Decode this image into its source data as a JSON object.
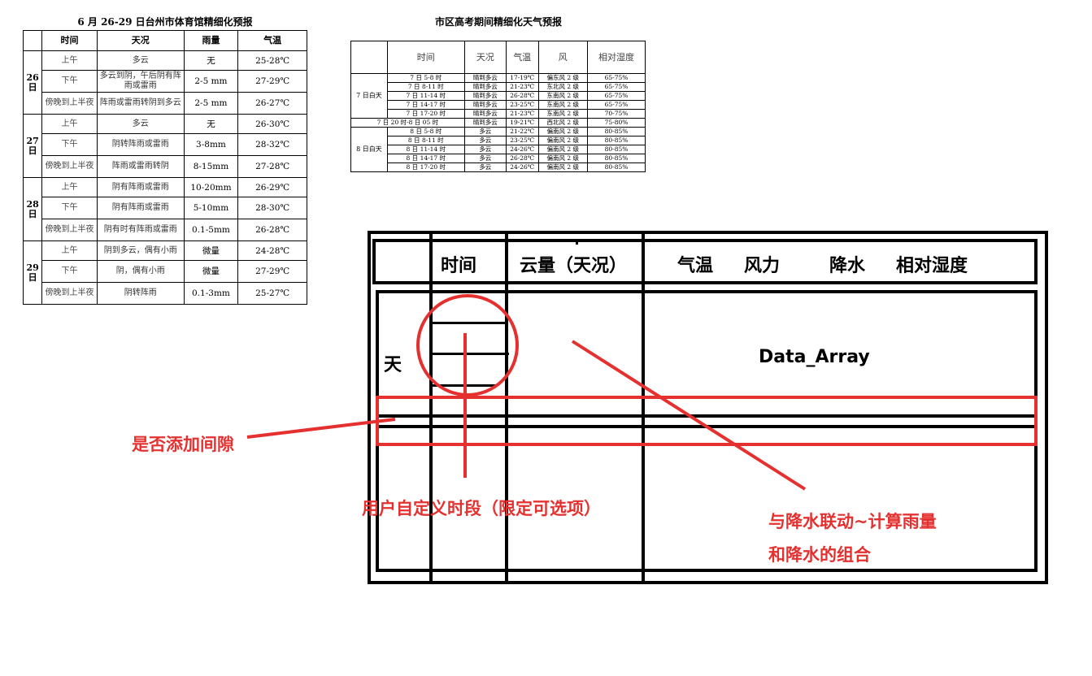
{
  "table1": {
    "title": "6 月 26-29 日台州市体育馆精细化预报",
    "headers": [
      "时间",
      "天况",
      "雨量",
      "气温"
    ],
    "days": [
      {
        "day": "26\n日",
        "rows": [
          {
            "seg": "上午",
            "wx": "多云",
            "rain": "无",
            "temp": "25-28℃"
          },
          {
            "seg": "下午",
            "wx": "多云到阴，午后阴有阵雨或雷雨",
            "rain": "2-5 mm",
            "temp": "27-29℃"
          },
          {
            "seg": "傍晚到上半夜",
            "wx": "阵雨或雷雨转阴到多云",
            "rain": "2-5 mm",
            "temp": "26-27℃"
          }
        ]
      },
      {
        "day": "27\n日",
        "rows": [
          {
            "seg": "上午",
            "wx": "多云",
            "rain": "无",
            "temp": "26-30℃"
          },
          {
            "seg": "下午",
            "wx": "阴转阵雨或雷雨",
            "rain": "3-8mm",
            "temp": "28-32℃"
          },
          {
            "seg": "傍晚到上半夜",
            "wx": "阵雨或雷雨转阴",
            "rain": "8-15mm",
            "temp": "27-28℃"
          }
        ]
      },
      {
        "day": "28\n日",
        "rows": [
          {
            "seg": "上午",
            "wx": "阴有阵雨或雷雨",
            "rain": "10-20mm",
            "temp": "26-29℃"
          },
          {
            "seg": "下午",
            "wx": "阴有阵雨或雷雨",
            "rain": "5-10mm",
            "temp": "28-30℃"
          },
          {
            "seg": "傍晚到上半夜",
            "wx": "阴有时有阵雨或雷雨",
            "rain": "0.1-5mm",
            "temp": "26-28℃"
          }
        ]
      },
      {
        "day": "29\n日",
        "rows": [
          {
            "seg": "上午",
            "wx": "阴到多云，偶有小雨",
            "rain": "微量",
            "temp": "24-28℃"
          },
          {
            "seg": "下午",
            "wx": "阴，偶有小雨",
            "rain": "微量",
            "temp": "27-29℃"
          },
          {
            "seg": "傍晚到上半夜",
            "wx": "阴转阵雨",
            "rain": "0.1-3mm",
            "temp": "25-27℃"
          }
        ]
      }
    ]
  },
  "table2": {
    "title": "市区高考期间精细化天气预报",
    "headers": [
      "时间",
      "天况",
      "气温",
      "风",
      "相对湿度"
    ],
    "groups": [
      {
        "label": "7 日白天",
        "rows": [
          [
            "7 日 5-8 时",
            "晴到多云",
            "17-19℃",
            "偏东风 2 级",
            "65-75%"
          ],
          [
            "7 日 8-11 时",
            "晴到多云",
            "21-23℃",
            "东北风 2 级",
            "65-75%"
          ],
          [
            "7 日 11-14 时",
            "晴到多云",
            "26-28℃",
            "东南风 2 级",
            "65-75%"
          ],
          [
            "7 日 14-17 时",
            "晴到多云",
            "23-25℃",
            "东南风 2 级",
            "65-75%"
          ],
          [
            "7 日 17-20 时",
            "晴到多云",
            "21-23℃",
            "东南风 2 级",
            "70-75%"
          ]
        ]
      },
      {
        "label": "",
        "span_row": [
          "7 日 20 时-8 日 05 时",
          "晴到多云",
          "19-21℃",
          "西北风 2 级",
          "75-80%"
        ]
      },
      {
        "label": "8 日白天",
        "rows": [
          [
            "8 日 5-8 时",
            "多云",
            "21-22℃",
            "偏南风 2 级",
            "80-85%"
          ],
          [
            "8 日 8-11 时",
            "多云",
            "23-25℃",
            "偏南风 2 级",
            "80-85%"
          ],
          [
            "8 日 11-14 时",
            "多云",
            "24-26℃",
            "偏南风 2 级",
            "80-85%"
          ],
          [
            "8 日 14-17 时",
            "多云",
            "26-28℃",
            "偏南风 2 级",
            "80-85%"
          ],
          [
            "8 日 17-20 时",
            "多云",
            "24-26℃",
            "偏南风 2 级",
            "80-85%"
          ]
        ]
      }
    ]
  },
  "sketch": {
    "headers": {
      "time": "时间",
      "cloud": "云量（天况）",
      "temp": "气温",
      "wind": "风力",
      "rain": "降水",
      "humidity": "相对湿度"
    },
    "day_label": "天",
    "data_array": "Data_Array"
  },
  "annotations": {
    "gap": "是否添加间隙",
    "custom_period": "用户自定义时段（限定可选项）",
    "rain_link_1": "与降水联动~计算雨量",
    "rain_link_2": "和降水的组合"
  },
  "colors": {
    "annotation": "#e53030",
    "line": "#000000"
  }
}
